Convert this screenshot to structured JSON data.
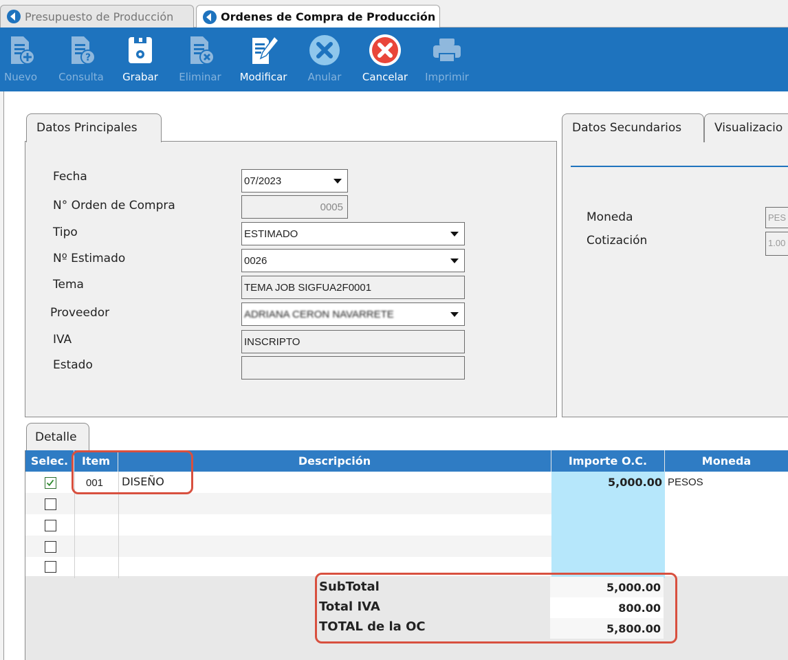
{
  "tabs": [
    {
      "label": "Presupuesto de Producción",
      "active": false
    },
    {
      "label": "Ordenes de Compra de Producción",
      "active": true
    }
  ],
  "toolbar": {
    "nuevo": "Nuevo",
    "consulta": "Consulta",
    "grabar": "Grabar",
    "eliminar": "Eliminar",
    "modificar": "Modificar",
    "anular": "Anular",
    "cancelar": "Cancelar",
    "imprimir": "Imprimir"
  },
  "colors": {
    "toolbar": "#1e73be",
    "grid_header": "#2f7cc4",
    "importe_cell": "#b6e7fb",
    "highlight": "#d8503f"
  },
  "icons": [
    "nuevo-doc-icon",
    "consulta-doc-icon",
    "grabar-save-icon",
    "eliminar-doc-icon",
    "modificar-edit-icon",
    "anular-x-icon",
    "cancelar-x-icon",
    "imprimir-printer-icon"
  ],
  "main_panel": {
    "tab": "Datos Principales",
    "fields": {
      "fecha": {
        "label": "Fecha",
        "value": "07/2023"
      },
      "orden": {
        "label": "N° Orden de Compra",
        "value": "0005"
      },
      "tipo": {
        "label": "Tipo",
        "value": "ESTIMADO"
      },
      "estimado": {
        "label": "Nº Estimado",
        "value": "0026"
      },
      "tema": {
        "label": "Tema",
        "value": "TEMA JOB SIGFUA2F0001"
      },
      "proveedor": {
        "label": "Proveedor",
        "value": "ADRIANA CERON NAVARRETE"
      },
      "iva": {
        "label": "IVA",
        "value": "INSCRIPTO"
      },
      "estado": {
        "label": "Estado",
        "value": ""
      }
    }
  },
  "secondary_panel": {
    "tab1": "Datos Secundarios",
    "tab2": "Visualizacio",
    "moneda": {
      "label": "Moneda",
      "value": "PES"
    },
    "cotizacion": {
      "label": "Cotización",
      "value": "1.00"
    }
  },
  "detalle": {
    "tab": "Detalle",
    "headers": {
      "selec": "Selec.",
      "item": "Item",
      "descripcion": "Descripción",
      "importe": "Importe O.C.",
      "moneda": "Moneda"
    },
    "rows": [
      {
        "selected": true,
        "item": "001",
        "descripcion": "DISEÑO",
        "importe": "5,000.00",
        "moneda": "PESOS"
      },
      {
        "selected": false,
        "item": "",
        "descripcion": "",
        "importe": "",
        "moneda": ""
      },
      {
        "selected": false,
        "item": "",
        "descripcion": "",
        "importe": "",
        "moneda": ""
      },
      {
        "selected": false,
        "item": "",
        "descripcion": "",
        "importe": "",
        "moneda": ""
      },
      {
        "selected": false,
        "item": "",
        "descripcion": "",
        "importe": "",
        "moneda": ""
      }
    ]
  },
  "totals": {
    "subtotal": {
      "label": "SubTotal",
      "value": "5,000.00"
    },
    "iva": {
      "label": "Total IVA",
      "value": "800.00"
    },
    "total": {
      "label": "TOTAL de la OC",
      "value": "5,800.00"
    }
  }
}
